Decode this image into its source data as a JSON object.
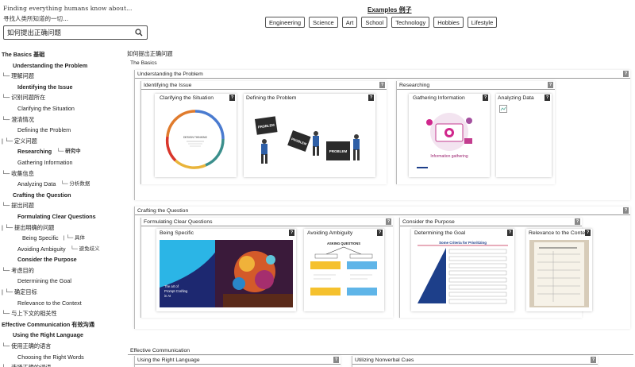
{
  "header": {
    "tagline": "Finding everything humans know about...",
    "tagline_cn": "寻找人类所知道的一切...",
    "search_value": "如何提出正确问题"
  },
  "examples": {
    "title": "Examples 例子",
    "chips": [
      "Engineering",
      "Science",
      "Art",
      "School",
      "Technology",
      "Hobbies",
      "Lifestyle"
    ]
  },
  "outline": [
    {
      "text": "The Basics 基础",
      "bold": true,
      "indent": 0
    },
    {
      "text": "Understanding the Problem",
      "bold": true,
      "indent": 1
    },
    {
      "text": "└─ 理解问题",
      "bold": false,
      "indent": 0
    },
    {
      "text": "Identifying the Issue",
      "bold": true,
      "indent": 2
    },
    {
      "text": "└─ 识别问题所在",
      "bold": false,
      "indent": 0
    },
    {
      "text": "Clarifying the Situation",
      "bold": false,
      "indent": 2
    },
    {
      "text": "└─ 澄清情况",
      "bold": false,
      "indent": 0
    },
    {
      "text": "Defining the Problem",
      "bold": false,
      "indent": 2
    },
    {
      "text": "| └─ 定义问题",
      "bold": false,
      "indent": 0
    },
    {
      "text": "Researching",
      "bold": true,
      "indent": 2,
      "note": "└─ 研究中"
    },
    {
      "text": "Gathering Information",
      "bold": false,
      "indent": 2
    },
    {
      "text": "└─ 收集信息",
      "bold": false,
      "indent": 0
    },
    {
      "text": "Analyzing Data",
      "bold": false,
      "indent": 2,
      "note": "└─ 分析数据"
    },
    {
      "text": "Crafting the Question",
      "bold": true,
      "indent": 1
    },
    {
      "text": "└─ 提出问题",
      "bold": false,
      "indent": 0
    },
    {
      "text": "Formulating Clear Questions",
      "bold": true,
      "indent": 2
    },
    {
      "text": "| └─ 提出明确的问题",
      "bold": false,
      "indent": 0
    },
    {
      "text": "Being Specific",
      "bold": false,
      "indent": 3,
      "note": "| └─ 具体"
    },
    {
      "text": "Avoiding Ambiguity",
      "bold": false,
      "indent": 2,
      "note": "└─ 避免歧义"
    },
    {
      "text": "Consider the Purpose",
      "bold": true,
      "indent": 2
    },
    {
      "text": "└─ 考虑目的",
      "bold": false,
      "indent": 0
    },
    {
      "text": "Determining the Goal",
      "bold": false,
      "indent": 2
    },
    {
      "text": "| └─ 确定目标",
      "bold": false,
      "indent": 0
    },
    {
      "text": "Relevance to the Context",
      "bold": false,
      "indent": 2
    },
    {
      "text": "└─ 与上下文的相关性",
      "bold": false,
      "indent": 0
    },
    {
      "text": "Effective Communication 有效沟通",
      "bold": true,
      "indent": 0
    },
    {
      "text": "Using the Right Language",
      "bold": true,
      "indent": 1
    },
    {
      "text": "└─ 使用正确的语言",
      "bold": false,
      "indent": 0
    },
    {
      "text": "Choosing the Right Words",
      "bold": false,
      "indent": 2
    },
    {
      "text": "└─ 选择正确的词语",
      "bold": false,
      "indent": 0
    }
  ],
  "canvas": {
    "root_title": "如何提出正确问题",
    "basics": "The Basics",
    "understanding": "Understanding the Problem",
    "identifying": "Identifying the Issue",
    "clarifying": "Clarifying the Situation",
    "defining": "Defining the Problem",
    "researching": "Researching",
    "gathering": "Gathering Information",
    "analyzing": "Analyzing Data",
    "crafting": "Crafting the Question",
    "formulating": "Formulating Clear Questions",
    "being_specific": "Being Specific",
    "avoiding": "Avoiding Ambiguity",
    "consider": "Consider the Purpose",
    "determining": "Determining the Goal",
    "relevance": "Relevance to the Context",
    "effective": "Effective Communication",
    "using_language": "Using the Right Language",
    "nonverbal": "Utilizing Nonverbal Cues",
    "help_glyph": "?"
  },
  "image_text": {
    "problem": "PROBLEM",
    "info_gathering": "Information gathering",
    "asking_questions": "ASKING QUESTIONS",
    "priorities": "Some Criteria for Prioritizing",
    "art_caption_1": "The art of",
    "art_caption_2": "Prompt Crafting",
    "art_caption_3": "in AI",
    "circle_center": "DESIGN THINKING"
  },
  "colors": {
    "accent_blue": "#1d3f8a",
    "magenta": "#d0278c",
    "cyan": "#2bb5e6"
  }
}
